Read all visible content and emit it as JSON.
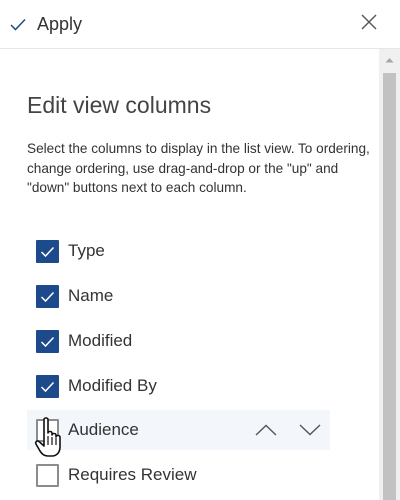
{
  "topbar": {
    "apply_label": "Apply"
  },
  "panel": {
    "title": "Edit view columns",
    "description": "Select the columns to display in the list view. To ordering, change ordering, use drag-and-drop or the \"up\" and \"down\" buttons next to each column."
  },
  "columns": [
    {
      "label": "Type",
      "checked": true
    },
    {
      "label": "Name",
      "checked": true
    },
    {
      "label": "Modified",
      "checked": true
    },
    {
      "label": "Modified By",
      "checked": true
    },
    {
      "label": "Audience",
      "checked": false
    },
    {
      "label": "Requires Review",
      "checked": false
    }
  ],
  "icons": {
    "apply": "checkmark-icon",
    "close": "close-icon",
    "move_up": "chevron-up-icon",
    "move_down": "chevron-down-icon",
    "cursor": "hand-pointer-icon"
  },
  "colors": {
    "checkbox_checked": "#1d4a8a",
    "checkbox_unchecked_border": "#8c8c8c",
    "row_hover": "#f3f6fb",
    "accent": "#1d4a8a"
  }
}
